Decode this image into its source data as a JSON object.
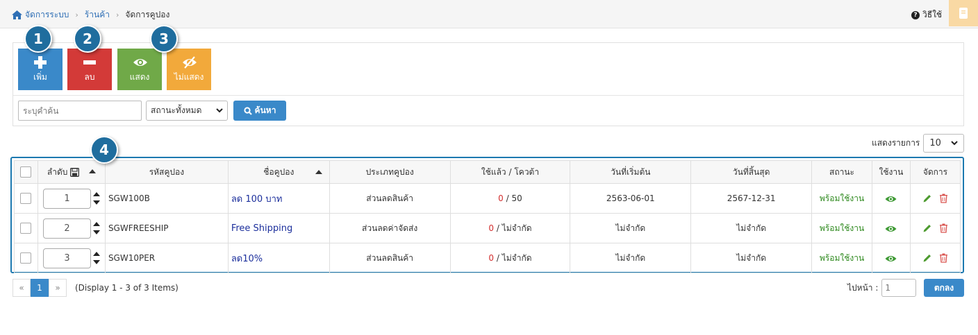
{
  "breadcrumb": {
    "home": "จัดการระบบ",
    "section": "ร้านค้า",
    "current": "จัดการคูปอง"
  },
  "help": {
    "label": "วิธีใช้"
  },
  "toolbar": {
    "add_label": "เพิ่ม",
    "delete_label": "ลบ",
    "show_label": "แสดง",
    "hide_label": "ไม่แสดง",
    "badges": [
      "1",
      "2",
      "3",
      "4"
    ]
  },
  "search": {
    "placeholder": "ระบุคำค้น",
    "status_selected": "สถานะทั้งหมด",
    "button_label": "ค้นหา"
  },
  "perpage": {
    "label": "แสดงรายการ",
    "value": "10"
  },
  "table": {
    "headers": {
      "order": "ลำดับ",
      "code": "รหัสคูปอง",
      "name": "ชื่อคูปอง",
      "type": "ประเภทคูปอง",
      "used_quota": "ใช้แล้ว / โควต้า",
      "start": "วันที่เริ่มต้น",
      "end": "วันที่สิ้นสุด",
      "status": "สถานะ",
      "active": "ใช้งาน",
      "manage": "จัดการ"
    },
    "rows": [
      {
        "order": "1",
        "code": "SGW100B",
        "name": "ลด 100 บาท",
        "type": "ส่วนลดสินค้า",
        "used": "0",
        "quota": " / 50",
        "start": "2563-06-01",
        "end": "2567-12-31",
        "status": "พร้อมใช้งาน"
      },
      {
        "order": "2",
        "code": "SGWFREESHIP",
        "name": "Free Shipping",
        "type": "ส่วนลดค่าจัดส่ง",
        "used": "0",
        "quota": " / ไม่จำกัด",
        "start": "ไม่จำกัด",
        "end": "ไม่จำกัด",
        "status": "พร้อมใช้งาน"
      },
      {
        "order": "3",
        "code": "SGW10PER",
        "name": "ลด10%",
        "type": "ส่วนลดสินค้า",
        "used": "0",
        "quota": " / ไม่จำกัด",
        "start": "ไม่จำกัด",
        "end": "ไม่จำกัด",
        "status": "พร้อมใช้งาน"
      }
    ]
  },
  "pagination": {
    "prev": "«",
    "current": "1",
    "next": "»",
    "display_text": "(Display 1 - 3 of 3 Items)",
    "goto_label": "ไปหน้า :",
    "goto_value": "1",
    "ok_label": "ตกลง"
  },
  "colors": {
    "primary": "#3a89c9",
    "danger": "#d33a38",
    "success": "#70a948",
    "warning": "#f2a93b",
    "badge": "#1f6d9e",
    "highlight_border": "#1c79b0"
  }
}
